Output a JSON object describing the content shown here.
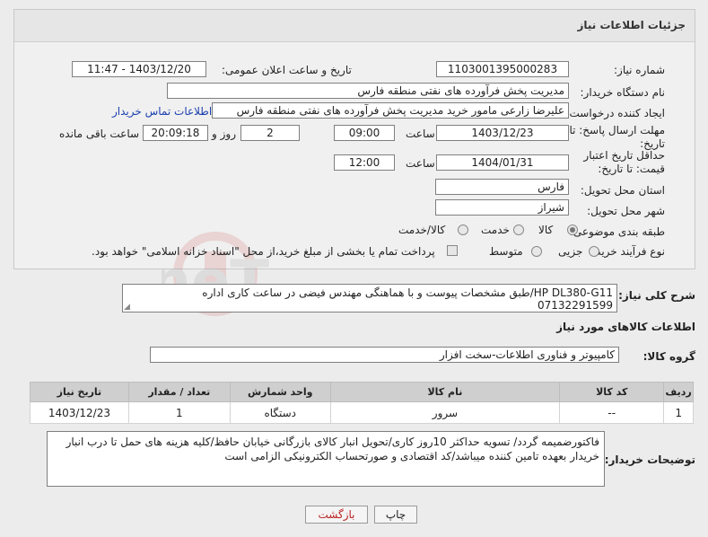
{
  "panel": {
    "title": "جزئیات اطلاعات نیاز"
  },
  "fields": {
    "need_number_label": "شماره نیاز:",
    "need_number": "1103001395000283",
    "announce_label": "تاریخ و ساعت اعلان عمومی:",
    "announce_value": "1403/12/20 - 11:47",
    "buyer_org_label": "نام دستگاه خریدار:",
    "buyer_org": "مدیریت پخش فرآورده های نفتی منطقه فارس",
    "creator_label": "ایجاد کننده درخواست:",
    "creator": "علیرضا زارعی مامور خرید مدیریت پخش فرآورده های نفتی منطقه فارس",
    "contact_link": "اطلاعات تماس خریدار",
    "deadline_label": "مهلت ارسال پاسخ: تا تاریخ:",
    "deadline_date": "1403/12/23",
    "time_label": "ساعت",
    "deadline_time": "09:00",
    "days_value": "2",
    "days_label": "روز و",
    "remaining_time": "20:09:18",
    "remaining_label": "ساعت باقی مانده",
    "validity_label": "حداقل تاریخ اعتبار قیمت: تا تاریخ:",
    "validity_date": "1404/01/31",
    "validity_time_label": "ساعت",
    "validity_time": "12:00",
    "province_label": "استان محل تحویل:",
    "province": "فارس",
    "city_label": "شهر محل تحویل:",
    "city": "شیراز",
    "category_label": "طبقه بندی موضوعی:",
    "category_options": [
      "کالا",
      "خدمت",
      "کالا/خدمت"
    ],
    "process_label": "نوع فرآیند خرید :",
    "process_options": [
      "جزیی",
      "متوسط"
    ],
    "payment_note": "پرداخت تمام یا بخشی از مبلغ خرید،از محل \"اسناد خزانه اسلامی\" خواهد بود."
  },
  "description": {
    "label": "شرح کلی نیاز:",
    "text": "HP DL380-G11/طبق مشخصات پیوست و با هماهنگی مهندس فیضی در ساعت کاری اداره 07132291599"
  },
  "goods_info_title": "اطلاعات کالاهای مورد نیاز",
  "goods_group": {
    "label": "گروه کالا:",
    "value": "کامپیوتر و فناوری اطلاعات-سخت افزار"
  },
  "table": {
    "headers": [
      "ردیف",
      "کد کالا",
      "نام کالا",
      "واحد شمارش",
      "تعداد / مقدار",
      "تاریخ نیاز"
    ],
    "rows": [
      [
        "1",
        "--",
        "سرور",
        "دستگاه",
        "1",
        "1403/12/23"
      ]
    ]
  },
  "buyer_notes": {
    "label": "توضیحات خریدار:",
    "text": "فاکتورضمیمه گردد/ تسویه حداکثر 10روز کاری/تحویل انبار کالای بازرگانی خیابان حافظ/کلیه هزینه های حمل تا درب انبار خریدار بعهده تامین کننده میباشد/کد اقتصادی و صورتحساب الکترونیکی الزامی است"
  },
  "buttons": {
    "print": "چاپ",
    "back": "بازگشت"
  },
  "watermark": "AriaTender.neT"
}
